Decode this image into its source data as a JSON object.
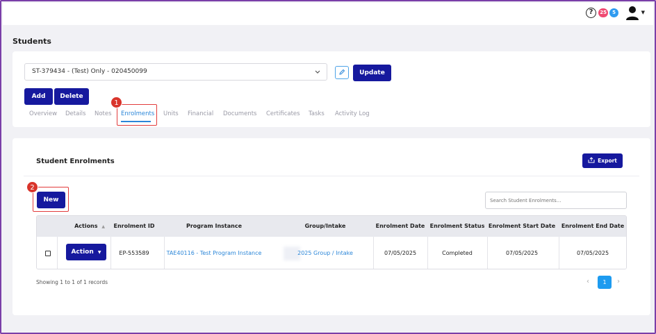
{
  "topbar": {
    "help_glyph": "?",
    "badge_red": "25",
    "badge_blue": "5"
  },
  "page": {
    "title": "Students"
  },
  "student": {
    "selected": "ST-379434 - (Test) Only - 020450099",
    "update_label": "Update",
    "add_label": "Add",
    "delete_label": "Delete"
  },
  "tabs": [
    {
      "label": "Overview"
    },
    {
      "label": "Details"
    },
    {
      "label": "Notes"
    },
    {
      "label": "Enrolments"
    },
    {
      "label": "Units"
    },
    {
      "label": "Financial"
    },
    {
      "label": "Documents"
    },
    {
      "label": "Certificates"
    },
    {
      "label": "Tasks"
    },
    {
      "label": "Activity Log"
    }
  ],
  "highlights": {
    "one": "1",
    "two": "2"
  },
  "enrolments": {
    "title": "Student Enrolments",
    "export_label": "Export",
    "new_label": "New",
    "search_placeholder": "Search Student Enrolments...",
    "columns": [
      "Actions",
      "Enrolment ID",
      "Program Instance",
      "Group/Intake",
      "Enrolment Date",
      "Enrolment Status",
      "Enrolment Start Date",
      "Enrolment End Date"
    ],
    "rows": [
      {
        "action_label": "Action",
        "enrolment_id": "EP-553589",
        "program_instance": "TAE40116 - Test Program Instance",
        "group_intake": "2025 Group / Intake",
        "enrolment_date": "07/05/2025",
        "status": "Completed",
        "start_date": "07/05/2025",
        "end_date": "07/05/2025"
      }
    ],
    "records_text": "Showing 1 to 1 of 1 records",
    "current_page": "1"
  },
  "colors": {
    "primary": "#16199e",
    "link": "#2b86d8",
    "highlight": "#e23b3b",
    "frame": "#7a3ea8"
  },
  "icons": {
    "help": "help-circle-icon",
    "user": "user-avatar-icon",
    "chevron": "chevron-down-icon",
    "edit": "pencil-icon",
    "export": "upload-icon",
    "sort": "sort-icon"
  }
}
